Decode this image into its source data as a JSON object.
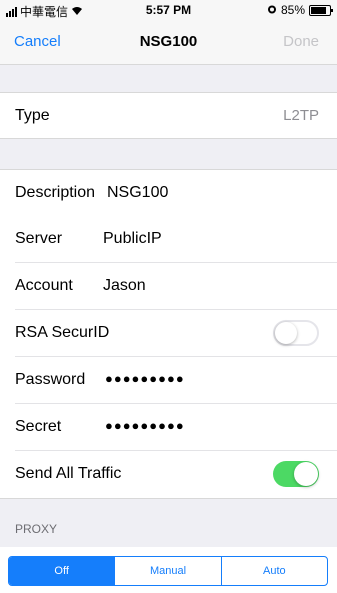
{
  "status": {
    "carrier": "中華電信",
    "time": "5:57 PM",
    "battery": "85%",
    "battery_level": 0.85
  },
  "nav": {
    "cancel": "Cancel",
    "title": "NSG100",
    "done": "Done"
  },
  "type": {
    "label": "Type",
    "value": "L2TP"
  },
  "fields": {
    "description": {
      "label": "Description",
      "value": "NSG100"
    },
    "server": {
      "label": "Server",
      "value": "PublicIP"
    },
    "account": {
      "label": "Account",
      "value": "Jason"
    },
    "rsa": {
      "label": "RSA SecurID",
      "on": false
    },
    "password": {
      "label": "Password",
      "value": "●●●●●●●●●"
    },
    "secret": {
      "label": "Secret",
      "value": "●●●●●●●●●"
    },
    "send_all": {
      "label": "Send All Traffic",
      "on": true
    }
  },
  "proxy": {
    "header": "PROXY",
    "options": [
      "Off",
      "Manual",
      "Auto"
    ],
    "selected": "Off"
  },
  "colors": {
    "accent": "#157efb",
    "toggle_on": "#4cd964"
  }
}
